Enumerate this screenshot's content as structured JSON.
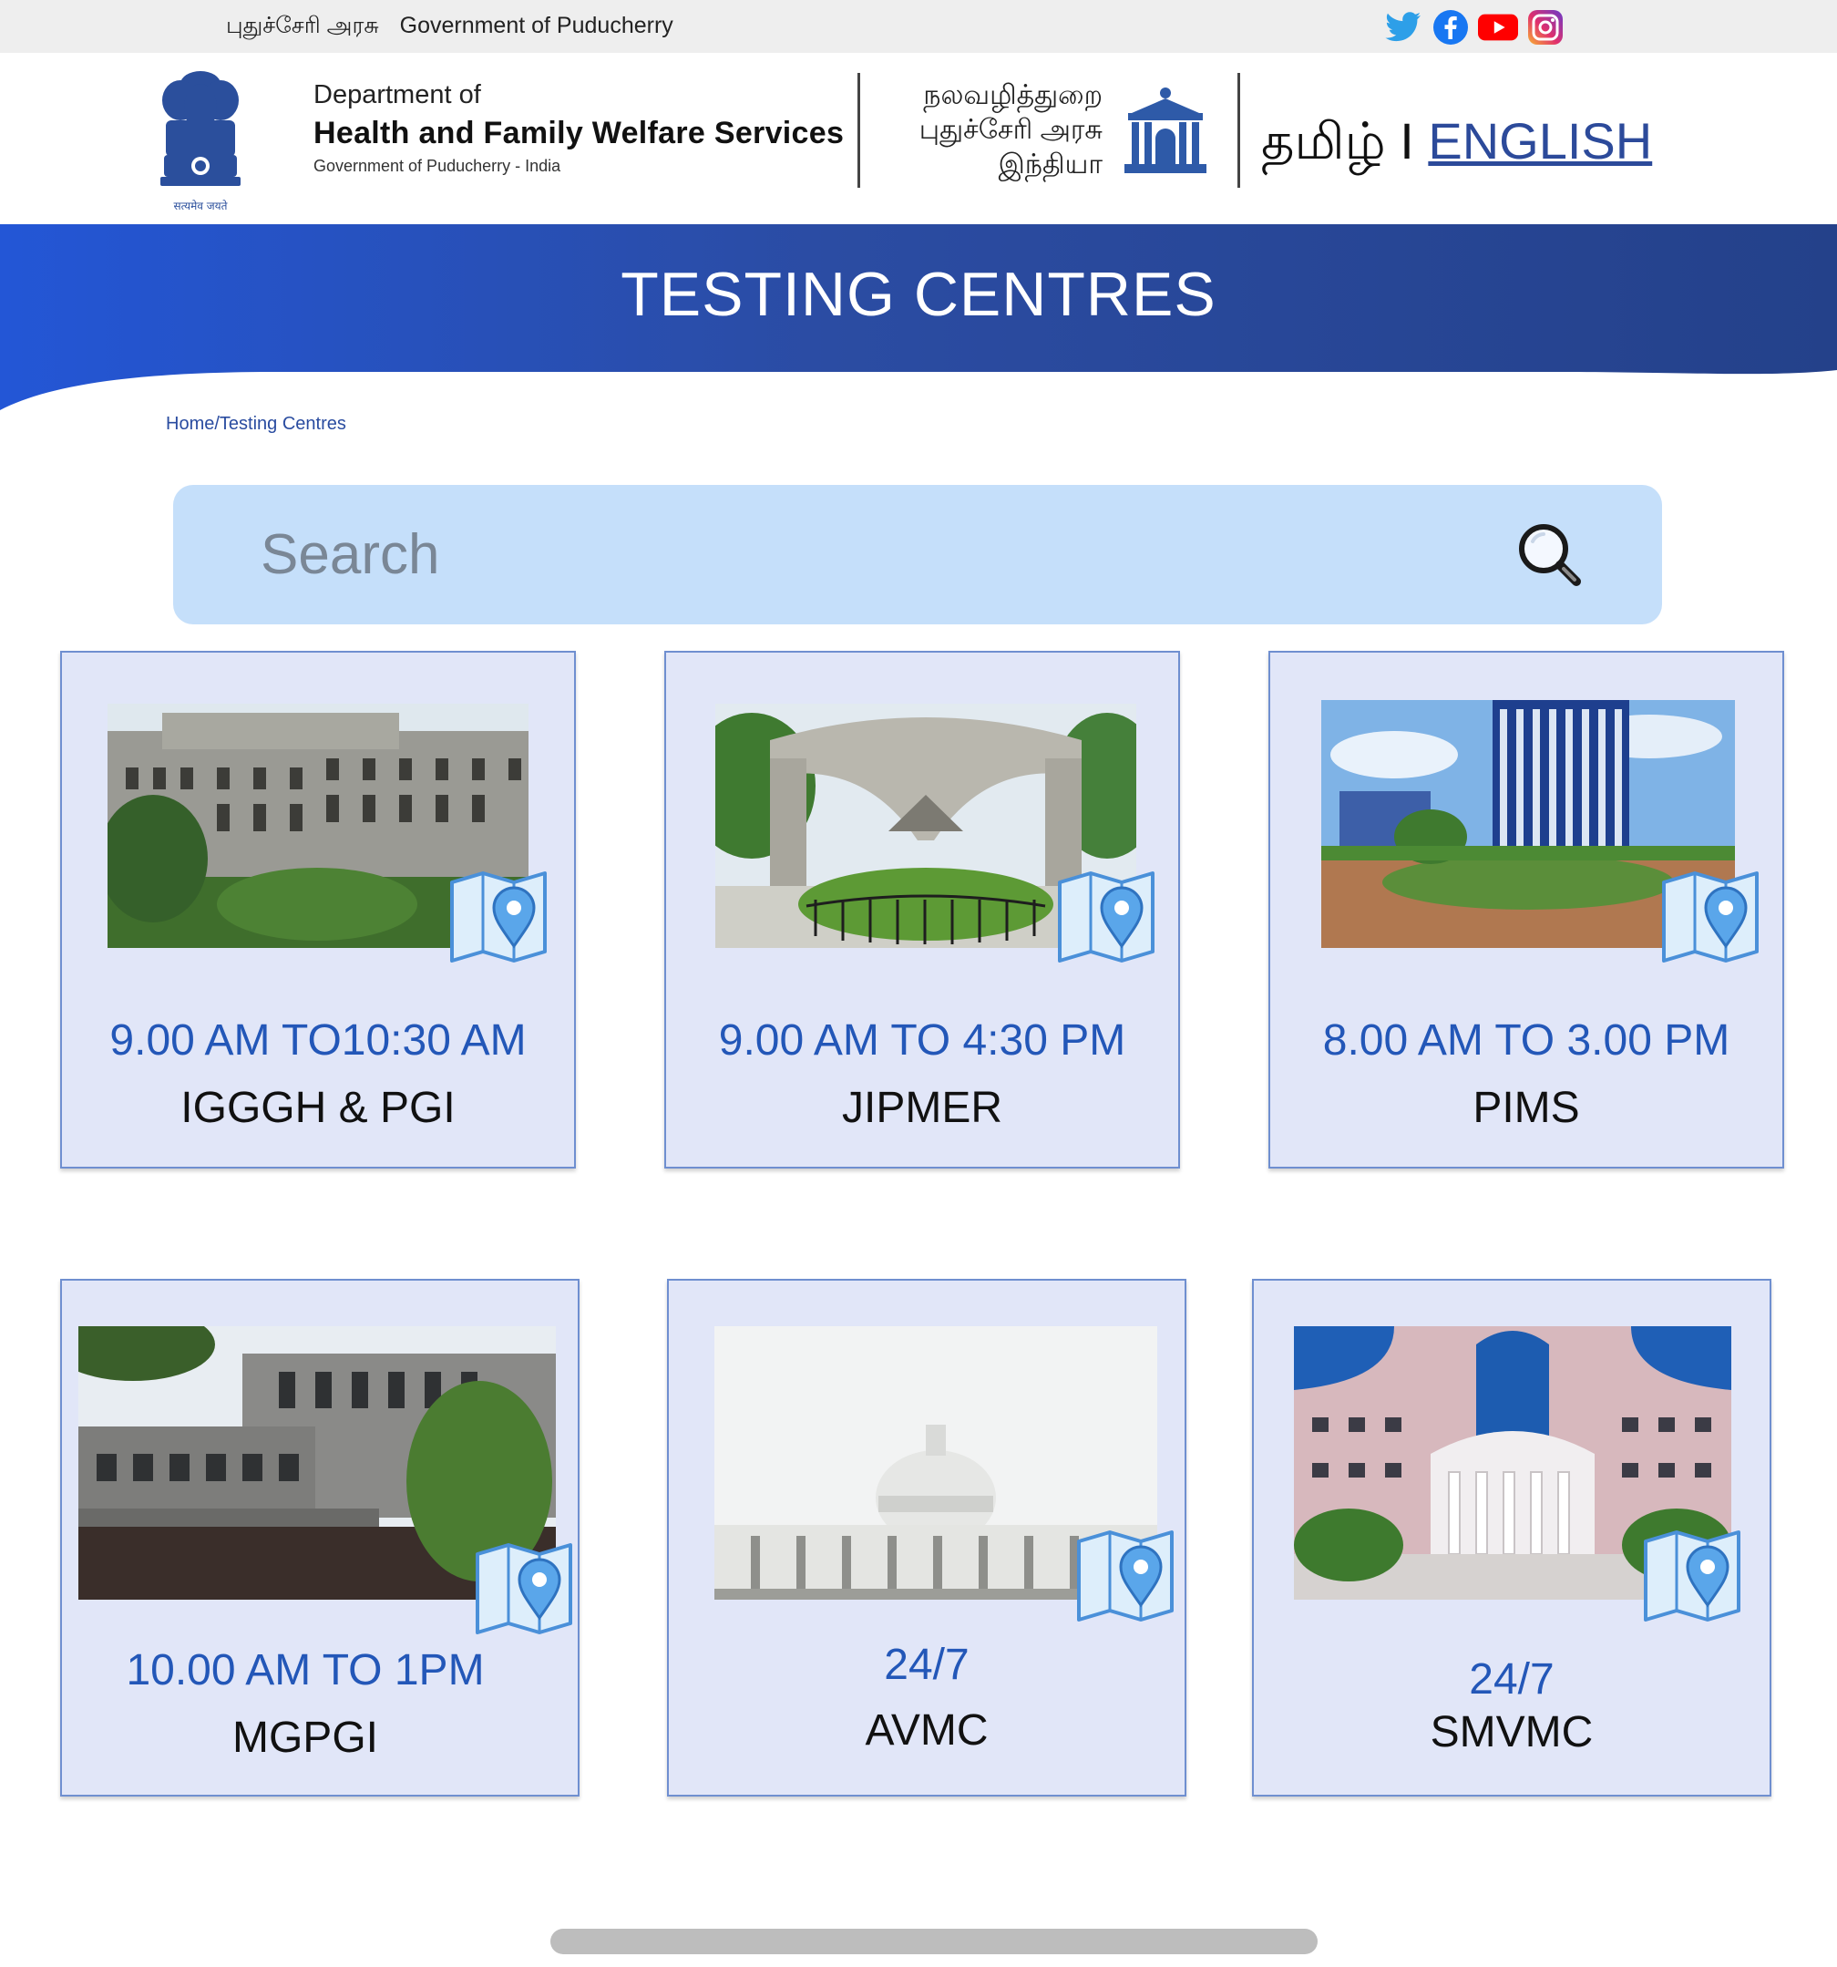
{
  "topbar": {
    "gov_tamil": "புதுச்சேரி அரசு",
    "gov_english": "Government of Puducherry",
    "social": [
      "twitter-icon",
      "facebook-icon",
      "youtube-icon",
      "instagram-icon"
    ]
  },
  "header": {
    "dept_line1": "Department of",
    "dept_line2": "Health and Family Welfare Services",
    "dept_line3": "Government of Puducherry - India",
    "emblem_caption": "सत्यमेव जयते",
    "tamil_line1": "நலவழித்துறை",
    "tamil_line2": "புதுச்சேரி அரசு",
    "tamil_line3": "இந்தியா",
    "lang_tamil": "தமிழ்",
    "lang_sep": "I",
    "lang_english": "ENGLISH"
  },
  "banner": {
    "title": "TESTING CENTRES",
    "color_left": "#2356d6",
    "color_right": "#24418a"
  },
  "breadcrumb": "Home/Testing Centres",
  "search": {
    "placeholder": "Search"
  },
  "colors": {
    "card_bg": "#e1e6f8",
    "time_text": "#2357b8",
    "search_bg": "#c5dffa"
  },
  "centres": [
    {
      "time": "9.00 AM TO10:30 AM",
      "name": "IGGGH & PGI"
    },
    {
      "time": "9.00 AM TO 4:30 PM",
      "name": "JIPMER"
    },
    {
      "time": "8.00 AM TO 3.00 PM",
      "name": "PIMS"
    },
    {
      "time": "10.00 AM TO 1PM",
      "name": "MGPGI"
    },
    {
      "time": "24/7",
      "name": "AVMC"
    },
    {
      "time": "24/7",
      "name": "SMVMC"
    }
  ]
}
